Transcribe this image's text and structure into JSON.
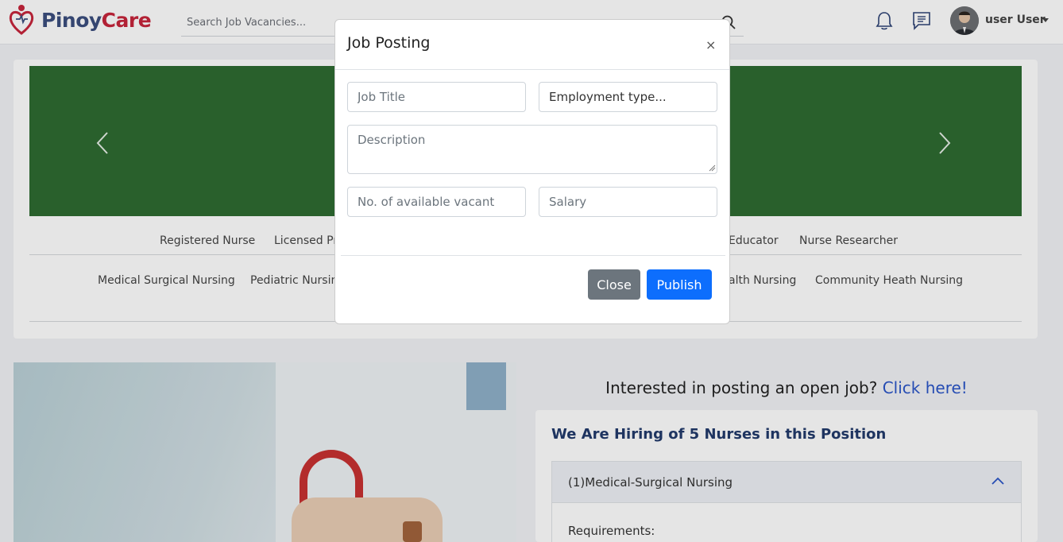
{
  "navbar": {
    "brand_pinoy": "Pinoy",
    "brand_care": "Care",
    "search_placeholder": "Search Job Vacancies...",
    "user_name": "user User"
  },
  "categories": {
    "row1": [
      "Registered Nurse",
      "Licensed Pr",
      "Educator",
      "Nurse Researcher"
    ],
    "row2": [
      "Medical Surgical Nursing",
      "Pediatric Nursin",
      "alth Nursing",
      "Community Heath Nursing"
    ]
  },
  "interest": {
    "text": "Interested in posting an open job?",
    "link": "Click here!"
  },
  "hiring": {
    "title": "We Are Hiring of 5 Nurses in this Position",
    "item_title": "(1)Medical-Surgical Nursing",
    "requirements": "Requirements:"
  },
  "modal": {
    "title": "Job Posting",
    "close_glyph": "×",
    "job_title_placeholder": "Job Title",
    "employment_type": "Employment type...",
    "description_placeholder": "Description",
    "vacant_placeholder": "No. of available vacant",
    "salary_placeholder": "Salary",
    "close_label": "Close",
    "publish_label": "Publish"
  },
  "colors": {
    "brand_pinoy": "#3b4e7e",
    "brand_care": "#c7253b",
    "carousel_bg": "#2e6b32",
    "publish_bg": "#0d6efd",
    "close_bg": "#6c757d"
  },
  "icons": [
    "heart-logo-icon",
    "search-icon",
    "bell-icon",
    "chat-icon",
    "avatar",
    "chevron-left-icon",
    "chevron-right-icon",
    "chevron-up-icon",
    "close-icon"
  ]
}
